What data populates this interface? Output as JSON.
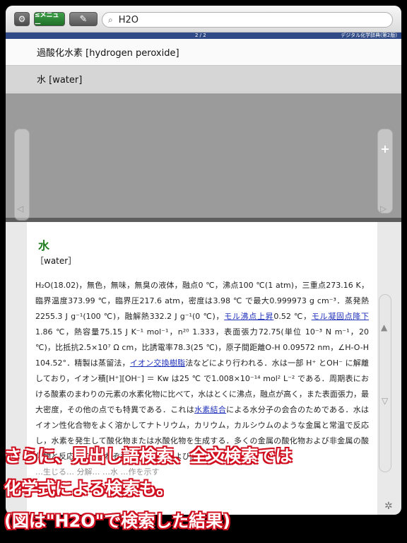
{
  "toolbar": {
    "settings_icon": "gear-icon",
    "menu_label": "≤メニュー",
    "pen_icon": "pen-icon",
    "search_value": "H2O"
  },
  "pagebar": {
    "count": "2 / 2",
    "dictionary": "デジタル化学辞典(第2版)"
  },
  "results": [
    {
      "label": "過酸化水素 [hydrogen peroxide]"
    },
    {
      "label": "水 [water]"
    }
  ],
  "entry": {
    "title": "水",
    "english": "［water］",
    "p1": "H₂O(18.02)，無色，無味，無臭の液体，融点0 ℃，沸点100 ℃(1 atm)，三重点273.16 K，臨界温度373.99 ℃，臨界圧217.6 atm，密度は3.98 ℃ で最大0.999973 g cm⁻³．蒸発熱2255.3 J g⁻¹(100 ℃)，融解熱332.2 J g⁻¹(0 ℃)，",
    "link1": "モル沸点上昇",
    "p2": "0.52 ℃，",
    "link2": "モル凝固点降下",
    "p3": "1.86 ℃，熱容量75.15 J K⁻¹ mol⁻¹，n²⁰ 1.333，表面張力72.75(単位 10⁻³ N m⁻¹，20 ℃)，比抵抗2.5×10⁷ Ω cm，比誘電率78.3(25 ℃)，原子間距離O-H 0.09572 nm，∠H-O-H 104.52°．精製は蒸留法，",
    "link3": "イオン交換樹脂",
    "p4": "法などにより行われる．水は一部 H⁺ とOH⁻ に解離しており，イオン積[H⁺][OH⁻] ＝ Kw は25 ℃ で1.008×10⁻¹⁴ mol² L⁻² である．周期表における酸素のまわりの元素の水素化物に比べて，水はとくに沸点，融点が高く，また表面張力，最大密度，その他の点でも特異である．これは",
    "link4": "水素結合",
    "p5": "による水分子の会合のためである．水はイオン性化合物をよく溶かしてナトリウム，カリウム，カルシウムのような金属と常温で反応し，水素を発生して酸化物または水酸化物を生成する．多くの金属の酸化物および非金属の酸化物と反応して，それぞれの水酸化物および酸",
    "p6": "…生じる… 分解… …水 …作を示す"
  },
  "caption": {
    "line1": "さらに、見出し語検索、全文検索では",
    "line2": "化学式による検索も。",
    "line3": "(図は\"H2O\"で検索した結果)"
  }
}
